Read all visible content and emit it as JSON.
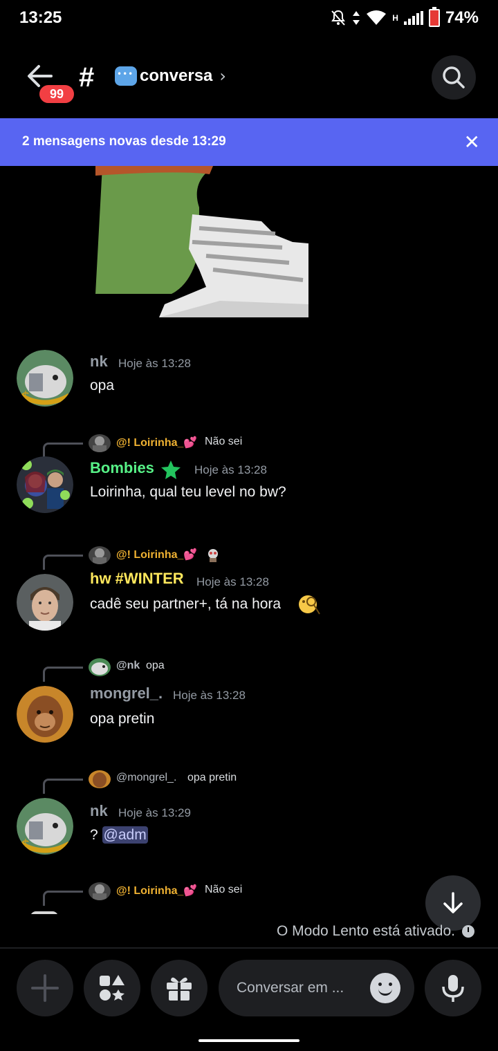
{
  "status_bar": {
    "time": "13:25",
    "network": "H",
    "battery": "74%"
  },
  "header": {
    "mention_count": "99",
    "channel_name": "conversa",
    "chevron": "›"
  },
  "banner": {
    "text": "2 mensagens novas desde 13:29",
    "close": "✕"
  },
  "messages": [
    {
      "username": "nk",
      "username_color": "#949ba4",
      "timestamp": "Hoje às 13:28",
      "content": "opa"
    },
    {
      "reply_to": "@! Loirinha_💕",
      "reply_text": "Não sei",
      "username": "Bombies",
      "username_color": "#57f287",
      "timestamp": "Hoje às 13:28",
      "content": "Loirinha, qual teu level no bw?"
    },
    {
      "reply_to": "@! Loirinha_💕",
      "reply_text": "",
      "username": "hw #WINTER",
      "username_color": "#fee75c",
      "timestamp": "Hoje às 13:28",
      "content": "cadê seu partner+, tá na hora"
    },
    {
      "reply_to": "@nk",
      "reply_text": "opa",
      "username": "mongrel_.",
      "username_color": "#949ba4",
      "timestamp": "Hoje às 13:28",
      "content": "opa pretin"
    },
    {
      "reply_to": "@mongrel_.",
      "reply_text": "opa pretin",
      "username": "nk",
      "username_color": "#949ba4",
      "timestamp": "Hoje às 13:29",
      "content_prefix": "? ",
      "mention": "@adm"
    },
    {
      "reply_to": "@! Loirinha_💕",
      "reply_text": "Não sei"
    }
  ],
  "colors": {
    "reply_gold": "#f0b232",
    "reply_muted": "#b5bac1",
    "blurple": "#5865f2"
  },
  "slowmode": "O Modo Lento está ativado.",
  "composer": {
    "placeholder": "Conversar em ..."
  },
  "icons": [
    "back-arrow-icon",
    "hash-icon",
    "chevron-right-icon",
    "search-icon",
    "close-icon",
    "jump-down-icon",
    "clock-icon",
    "plus-icon",
    "apps-icon",
    "gift-icon",
    "emoji-icon",
    "mic-icon"
  ]
}
